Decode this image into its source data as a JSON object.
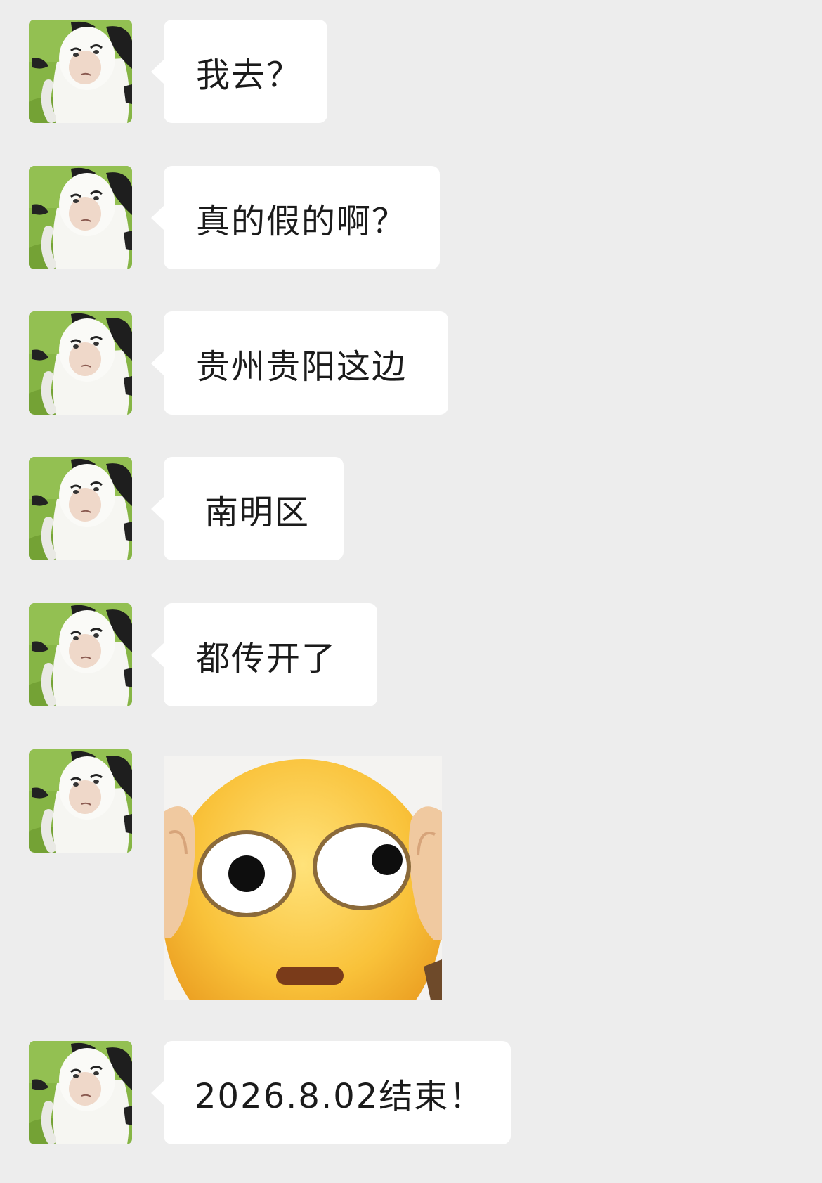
{
  "chat": {
    "sender_avatar_icon": "cow-character-avatar-icon",
    "sticker_icon": "shocked-emoji-sticker-icon",
    "colors": {
      "background": "#ededed",
      "bubble": "#ffffff",
      "text": "#1b1b1b",
      "avatar_grass": "#7fae3c"
    },
    "messages": [
      {
        "type": "text",
        "text": "我去？"
      },
      {
        "type": "text",
        "text": "真的假的啊？"
      },
      {
        "type": "text",
        "text": "贵州贵阳这边"
      },
      {
        "type": "text",
        "text": "南明区"
      },
      {
        "type": "text",
        "text": "都传开了"
      },
      {
        "type": "sticker"
      },
      {
        "type": "text",
        "text": "2026.8.02结束！"
      }
    ]
  }
}
